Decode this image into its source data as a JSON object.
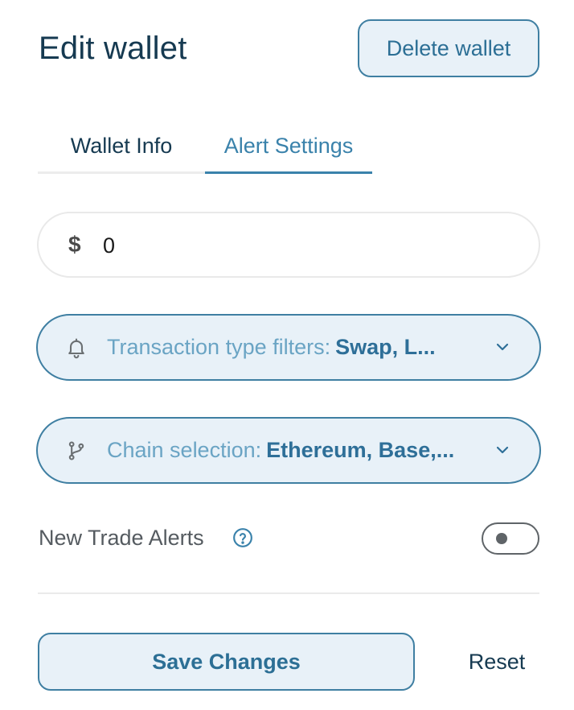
{
  "header": {
    "title": "Edit wallet",
    "delete_label": "Delete wallet"
  },
  "tabs": [
    {
      "label": "Wallet Info",
      "active": false
    },
    {
      "label": "Alert Settings",
      "active": true
    }
  ],
  "amount": {
    "currency_symbol": "$",
    "value": "0"
  },
  "transaction_filter": {
    "icon": "bell-icon",
    "label": "Transaction type filters:",
    "value": "Swap, L..."
  },
  "chain_selection": {
    "icon": "branch-icon",
    "label": "Chain selection:",
    "value": "Ethereum, Base,..."
  },
  "new_trade_alerts": {
    "label": "New Trade Alerts",
    "enabled": false
  },
  "footer": {
    "save_label": "Save Changes",
    "reset_label": "Reset"
  },
  "colors": {
    "accent": "#3a82ab",
    "title": "#163a51",
    "pill_background": "#e8f1f8",
    "pill_border": "#3f7fa2"
  }
}
